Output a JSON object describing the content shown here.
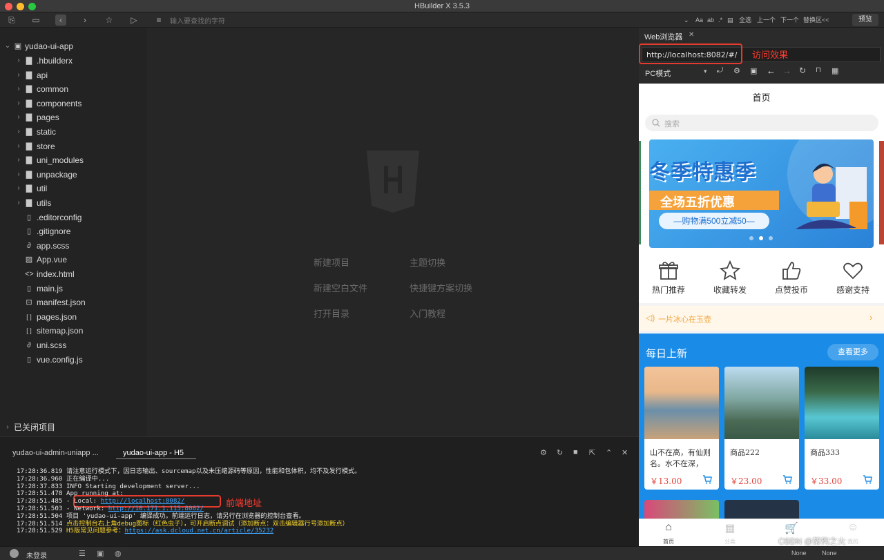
{
  "window": {
    "title": "HBuilder X 3.5.3"
  },
  "toolbar": {
    "search_placeholder": "输入要查找的字符",
    "find_aa": "Aa",
    "select_all": "全选",
    "prev": "上一个",
    "next": "下一个",
    "replace": "替换区<<",
    "preview": "预览"
  },
  "project": {
    "root": "yudao-ui-app",
    "items": [
      {
        "label": ".hbuilderx",
        "type": "folder"
      },
      {
        "label": "api",
        "type": "folder"
      },
      {
        "label": "common",
        "type": "folder"
      },
      {
        "label": "components",
        "type": "folder"
      },
      {
        "label": "pages",
        "type": "folder"
      },
      {
        "label": "static",
        "type": "folder"
      },
      {
        "label": "store",
        "type": "folder"
      },
      {
        "label": "uni_modules",
        "type": "folder"
      },
      {
        "label": "unpackage",
        "type": "folder"
      },
      {
        "label": "util",
        "type": "folder"
      },
      {
        "label": "utils",
        "type": "folder"
      },
      {
        "label": ".editorconfig",
        "type": "file"
      },
      {
        "label": ".gitignore",
        "type": "file"
      },
      {
        "label": "app.scss",
        "type": "style"
      },
      {
        "label": "App.vue",
        "type": "vue"
      },
      {
        "label": "index.html",
        "type": "html"
      },
      {
        "label": "main.js",
        "type": "file"
      },
      {
        "label": "manifest.json",
        "type": "manifest"
      },
      {
        "label": "pages.json",
        "type": "json"
      },
      {
        "label": "sitemap.json",
        "type": "json"
      },
      {
        "label": "uni.scss",
        "type": "style"
      },
      {
        "label": "vue.config.js",
        "type": "file"
      }
    ],
    "closed_projects": "已关闭项目"
  },
  "welcome": {
    "new_project": "新建项目",
    "theme_switch": "主题切换",
    "new_blank_file": "新建空白文件",
    "shortcut_switch": "快捷键方案切换",
    "open_dir": "打开目录",
    "tutorial": "入门教程"
  },
  "console": {
    "tabs": [
      "yudao-ui-admin-uniapp ...",
      "yudao-ui-app - H5"
    ],
    "lines": [
      {
        "t": "17:28:36.819",
        "text": "请注意运行模式下，因日志输出、sourcemap以及未压缩源码等原因，性能和包体积，均不及发行模式。",
        "link": ""
      },
      {
        "t": "17:28:36.960",
        "text": "正在编译中...",
        "link": ""
      },
      {
        "t": "17:28:37.833",
        "text": " INFO  Starting development server...",
        "link": ""
      },
      {
        "t": "17:28:51.478",
        "text": "  App running at:",
        "link": ""
      },
      {
        "t": "17:28:51.485",
        "text": "  - Local:   ",
        "link": "http://localhost:8082/"
      },
      {
        "t": "17:28:51.503",
        "text": "  - Network: ",
        "link": "http://10.171.1.115:8082/"
      },
      {
        "t": "17:28:51.504",
        "text": "项目 'yudao-ui-app' 编译成功。前端运行日志，请另行在浏览器的控制台查看。",
        "link": ""
      },
      {
        "t": "17:28:51.514",
        "text": "点击控制台右上角debug图标（红色虫子），可开启断点调试（添加断点：双击编辑器行号添加断点）",
        "link": "",
        "yellow": true
      },
      {
        "t": "17:28:51.529",
        "text": "H5版常见问题参考：",
        "link": "https://ask.dcloud.net.cn/article/35232",
        "yellow": true
      }
    ],
    "annotation": "前端地址"
  },
  "status": {
    "login": "未登录",
    "none1": "None",
    "none2": "None"
  },
  "browser": {
    "tab": "Web浏览器",
    "url": "http://localhost:8082/#/",
    "annotation": "访问效果",
    "mode": "PC模式"
  },
  "app": {
    "nav_title": "首页",
    "search_placeholder": "搜索",
    "banner": {
      "title": "冬季特惠季",
      "sub": "全场五折优惠",
      "promo": "—购物满500立减50—"
    },
    "functions": [
      {
        "label": "热门推荐",
        "icon": "gift-icon"
      },
      {
        "label": "收藏转发",
        "icon": "star-icon"
      },
      {
        "label": "点赞投币",
        "icon": "thumb-up-icon"
      },
      {
        "label": "感谢支持",
        "icon": "heart-icon"
      }
    ],
    "notice": "一片冰心在玉壶",
    "daily": {
      "title": "每日上新",
      "more": "查看更多"
    },
    "products": [
      {
        "name": "山不在高，有仙则名。水不在深，",
        "price": "￥13.00"
      },
      {
        "name": "商品222",
        "price": "￥23.00"
      },
      {
        "name": "商品333",
        "price": "￥33.00"
      }
    ],
    "tabbar": [
      "首页",
      "分类",
      "购物车",
      "我的"
    ]
  },
  "watermark": "CSDN @架构之火",
  "colors": {
    "accent": "#1a8ce8",
    "red": "#e53b2c",
    "price": "#e3433a"
  }
}
